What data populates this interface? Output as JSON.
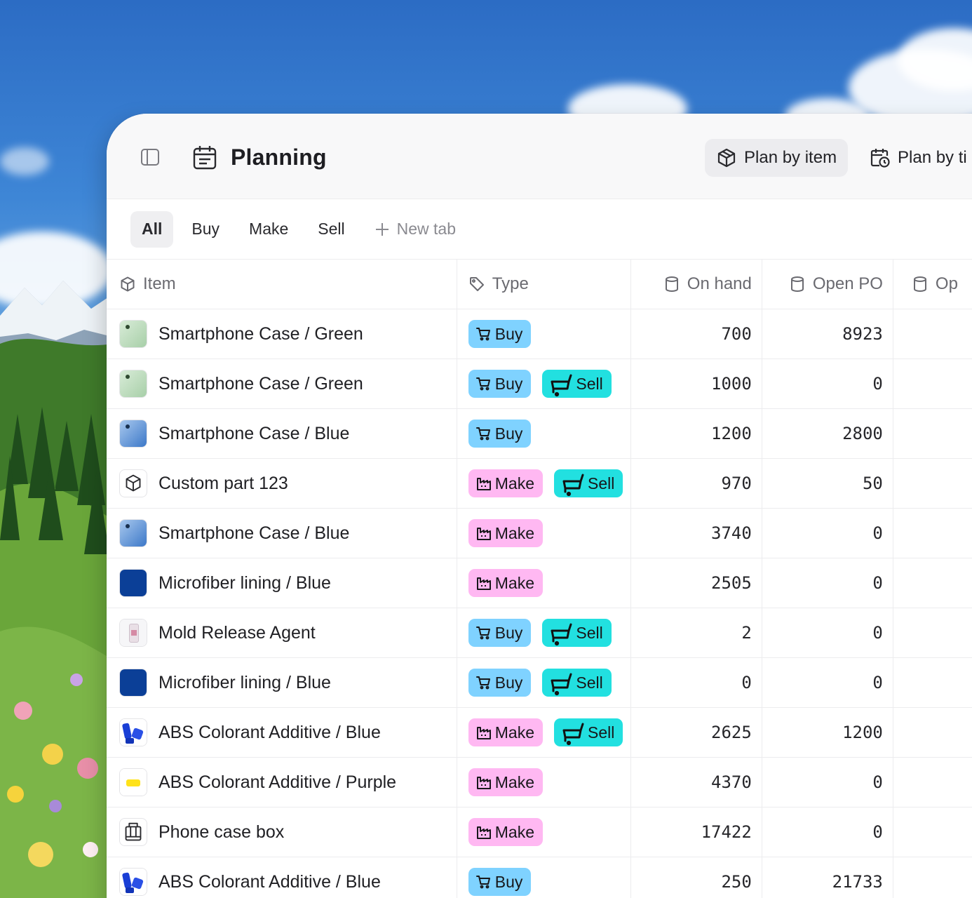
{
  "header": {
    "title": "Planning",
    "views": [
      {
        "label": "Plan by item",
        "icon": "cube-icon",
        "active": true
      },
      {
        "label": "Plan by ti",
        "icon": "calendar-clock-icon",
        "active": false
      }
    ]
  },
  "tabs": {
    "items": [
      "All",
      "Buy",
      "Make",
      "Sell"
    ],
    "active": "All",
    "new_tab_label": "New tab"
  },
  "table": {
    "columns": {
      "item": "Item",
      "type": "Type",
      "on_hand": "On hand",
      "open_po": "Open PO",
      "op": "Op"
    },
    "badge_labels": {
      "buy": "Buy",
      "make": "Make",
      "sell": "Sell"
    },
    "rows": [
      {
        "name": "Smartphone Case / Green",
        "thumb": "green-case",
        "types": [
          "buy"
        ],
        "on_hand": "700",
        "open_po": "8923"
      },
      {
        "name": "Smartphone Case / Green",
        "thumb": "green-case",
        "types": [
          "buy",
          "sell"
        ],
        "on_hand": "1000",
        "open_po": "0"
      },
      {
        "name": "Smartphone Case / Blue",
        "thumb": "blue-case",
        "types": [
          "buy"
        ],
        "on_hand": "1200",
        "open_po": "2800"
      },
      {
        "name": "Custom part 123",
        "thumb": "cube",
        "types": [
          "make",
          "sell"
        ],
        "on_hand": "970",
        "open_po": "50"
      },
      {
        "name": "Smartphone Case / Blue",
        "thumb": "blue-case",
        "types": [
          "make"
        ],
        "on_hand": "3740",
        "open_po": "0"
      },
      {
        "name": "Microfiber lining / Blue",
        "thumb": "navy-fabric",
        "types": [
          "make"
        ],
        "on_hand": "2505",
        "open_po": "0"
      },
      {
        "name": "Mold Release Agent",
        "thumb": "bottle",
        "types": [
          "buy",
          "sell"
        ],
        "on_hand": "2",
        "open_po": "0"
      },
      {
        "name": "Microfiber lining / Blue",
        "thumb": "navy-fabric",
        "types": [
          "buy",
          "sell"
        ],
        "on_hand": "0",
        "open_po": "0"
      },
      {
        "name": "ABS Colorant Additive / Blue",
        "thumb": "blue-pellets",
        "types": [
          "make",
          "sell"
        ],
        "on_hand": "2625",
        "open_po": "1200"
      },
      {
        "name": "ABS Colorant Additive / Purple",
        "thumb": "yellow-pellet",
        "types": [
          "make"
        ],
        "on_hand": "4370",
        "open_po": "0"
      },
      {
        "name": "Phone case box",
        "thumb": "box",
        "types": [
          "make"
        ],
        "on_hand": "17422",
        "open_po": "0"
      },
      {
        "name": "ABS Colorant Additive / Blue",
        "thumb": "blue-pellets",
        "types": [
          "buy"
        ],
        "on_hand": "250",
        "open_po": "21733"
      }
    ]
  },
  "colors": {
    "buy_badge": "#7fd2ff",
    "make_badge": "#ffb8f2",
    "sell_badge": "#22e0e0",
    "active_bg": "#ececef"
  }
}
